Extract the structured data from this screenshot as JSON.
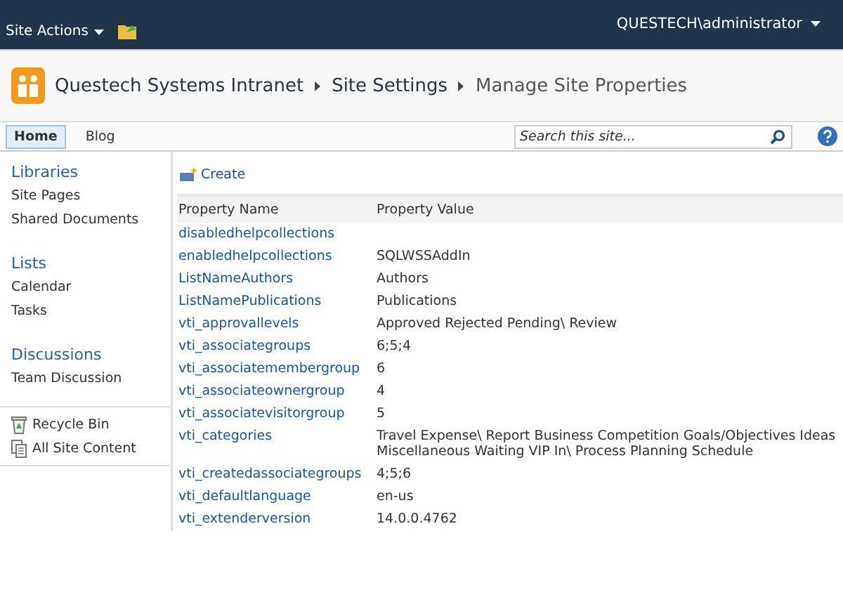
{
  "top_bar": {
    "site_actions": "Site Actions",
    "user": "QUESTECH\\administrator"
  },
  "breadcrumb": [
    "Questech Systems Intranet",
    "Site Settings",
    "Manage Site Properties"
  ],
  "nav_tabs": [
    {
      "label": "Home",
      "selected": true
    },
    {
      "label": "Blog",
      "selected": false
    }
  ],
  "search": {
    "placeholder": "Search this site..."
  },
  "sidebar": {
    "sections": [
      {
        "heading": "Libraries",
        "items": [
          "Site Pages",
          "Shared Documents"
        ]
      },
      {
        "heading": "Lists",
        "items": [
          "Calendar",
          "Tasks"
        ]
      },
      {
        "heading": "Discussions",
        "items": [
          "Team Discussion"
        ]
      }
    ],
    "footer_items": [
      {
        "kind": "recycle",
        "label": "Recycle Bin"
      },
      {
        "kind": "content",
        "label": "All Site Content"
      }
    ]
  },
  "toolbar": {
    "create": "Create"
  },
  "table": {
    "columns": [
      "Property Name",
      "Property Value"
    ],
    "rows": [
      {
        "name": "disabledhelpcollections",
        "value": ""
      },
      {
        "name": "enabledhelpcollections",
        "value": "SQLWSSAddIn"
      },
      {
        "name": "ListNameAuthors",
        "value": "Authors"
      },
      {
        "name": "ListNamePublications",
        "value": "Publications"
      },
      {
        "name": "vti_approvallevels",
        "value": "Approved Rejected Pending\\ Review"
      },
      {
        "name": "vti_associategroups",
        "value": "6;5;4"
      },
      {
        "name": "vti_associatemembergroup",
        "value": "6"
      },
      {
        "name": "vti_associateownergroup",
        "value": "4"
      },
      {
        "name": "vti_associatevisitorgroup",
        "value": "5"
      },
      {
        "name": "vti_categories",
        "value": "Travel Expense\\ Report Business Competition Goals/Objectives Ideas Miscellaneous Waiting VIP In\\ Process Planning Schedule"
      },
      {
        "name": "vti_createdassociategroups",
        "value": "4;5;6"
      },
      {
        "name": "vti_defaultlanguage",
        "value": "en-us"
      },
      {
        "name": "vti_extenderversion",
        "value": "14.0.0.4762"
      }
    ]
  }
}
